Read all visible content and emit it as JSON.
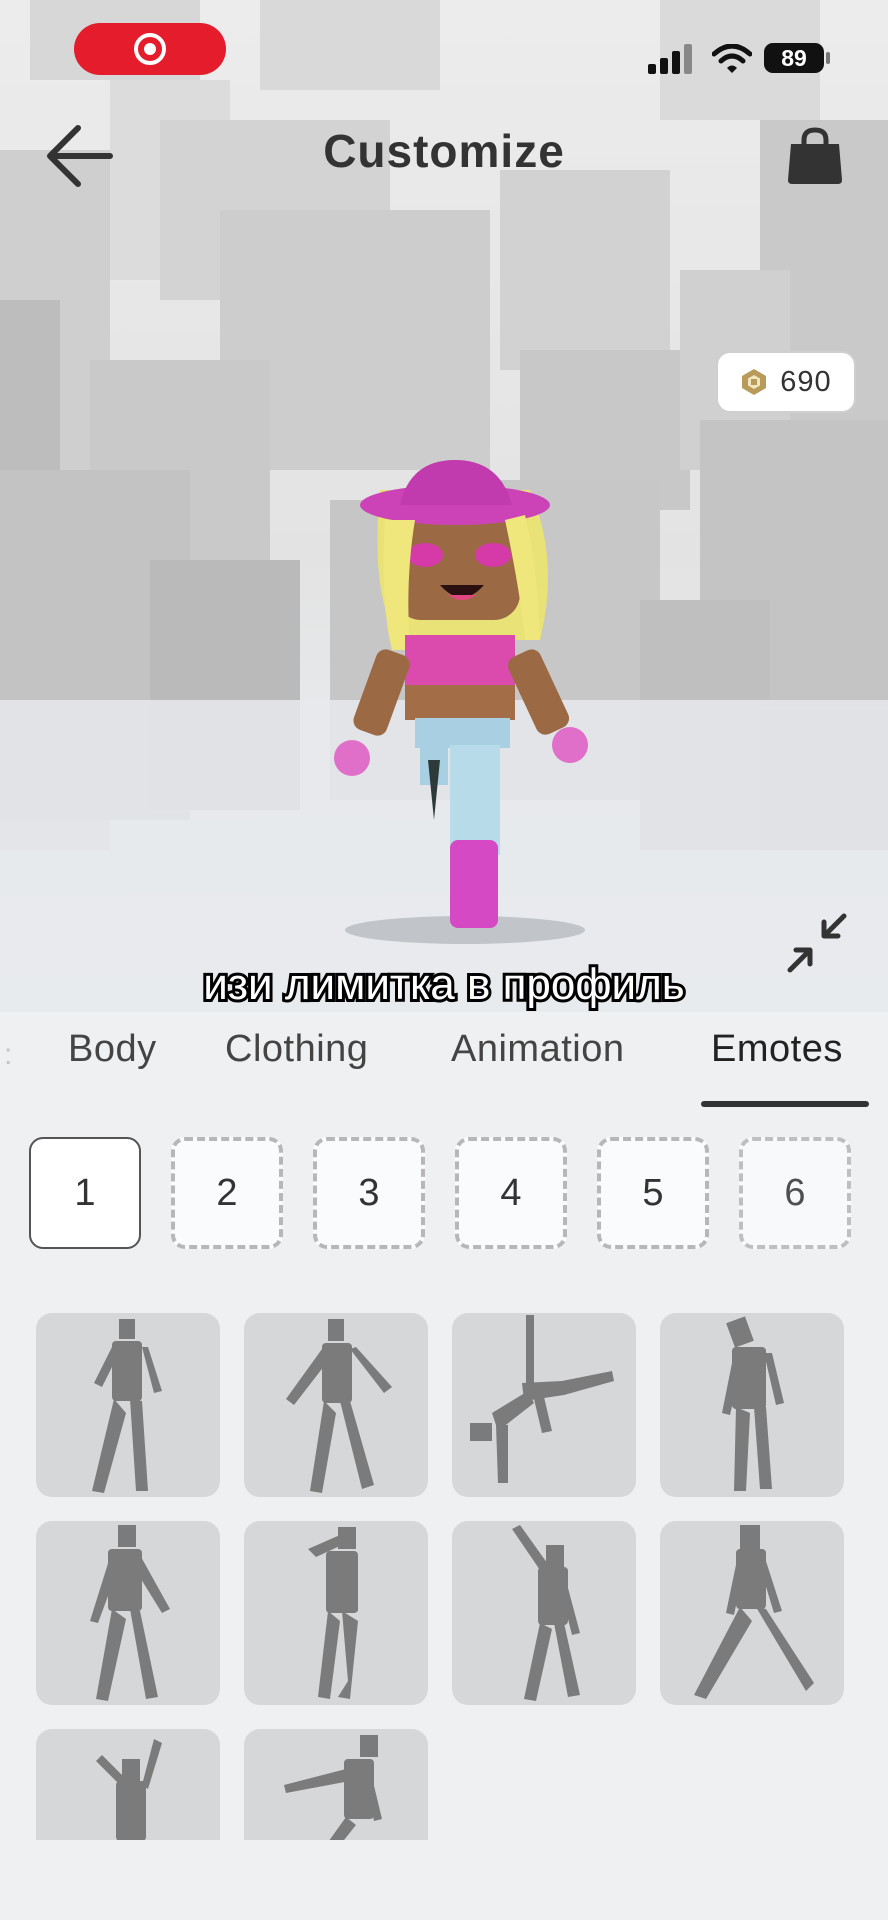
{
  "status_bar": {
    "battery": "89",
    "record_indicator": "red-record-pill",
    "signal_icon": "cellular-signal-icon",
    "wifi_icon": "wifi-icon"
  },
  "header": {
    "title": "Customize",
    "back_icon": "arrow-left-icon",
    "shop_icon": "shopping-bag-icon"
  },
  "robux": {
    "amount": "690",
    "icon": "robux-coin-icon"
  },
  "caption": "изи лимитка в профиль",
  "tabs": [
    {
      "label": "Body",
      "active": false
    },
    {
      "label": "Clothing",
      "active": false
    },
    {
      "label": "Animation",
      "active": false
    },
    {
      "label": "Emotes",
      "active": true
    }
  ],
  "slots": [
    {
      "label": "1",
      "selected": true
    },
    {
      "label": "2",
      "selected": false
    },
    {
      "label": "3",
      "selected": false
    },
    {
      "label": "4",
      "selected": false
    },
    {
      "label": "5",
      "selected": false
    },
    {
      "label": "6",
      "selected": false
    }
  ],
  "emotes_count_visible": 10,
  "colors": {
    "accent_red": "#e51c2b",
    "tab_underline": "#333333",
    "tile_bg": "#d6d7d8",
    "silhouette": "#7b7b7b"
  }
}
